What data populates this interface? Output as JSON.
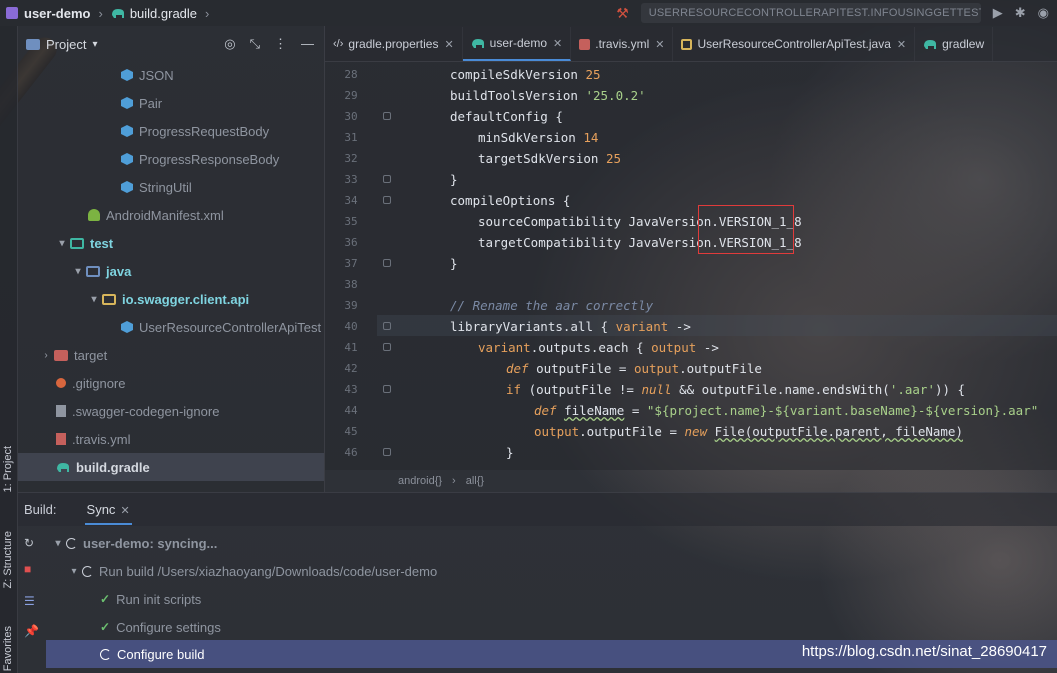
{
  "navbar": {
    "project": "user-demo",
    "file": "build.gradle",
    "run_config": "USERRESOURCECONTROLLERAPITEST.INFOUSINGGETTEST"
  },
  "toolstrip": {
    "project_tab": "1: Project",
    "structure_tab": "Z: Structure",
    "favorites_tab": "Favorites"
  },
  "project_panel": {
    "title": "Project",
    "items": [
      {
        "label": "JSON"
      },
      {
        "label": "Pair"
      },
      {
        "label": "ProgressRequestBody"
      },
      {
        "label": "ProgressResponseBody"
      },
      {
        "label": "StringUtil"
      },
      {
        "label": "AndroidManifest.xml"
      },
      {
        "label": "test"
      },
      {
        "label": "java"
      },
      {
        "label": "io.swagger.client.api"
      },
      {
        "label": "UserResourceControllerApiTest"
      },
      {
        "label": "target"
      },
      {
        "label": ".gitignore"
      },
      {
        "label": ".swagger-codegen-ignore"
      },
      {
        "label": ".travis.yml"
      },
      {
        "label": "build.gradle"
      }
    ]
  },
  "editor": {
    "tabs": [
      {
        "label": "gradle.properties"
      },
      {
        "label": "user-demo"
      },
      {
        "label": ".travis.yml"
      },
      {
        "label": "UserResourceControllerApiTest.java"
      },
      {
        "label": "gradlew"
      }
    ],
    "line_numbers": [
      "28",
      "29",
      "30",
      "31",
      "32",
      "33",
      "34",
      "35",
      "36",
      "37",
      "38",
      "39",
      "40",
      "41",
      "42",
      "43",
      "44",
      "45",
      "46"
    ],
    "code": {
      "l28_a": "compileSdkVersion ",
      "l28_b": "25",
      "l29_a": "buildToolsVersion ",
      "l29_b": "'25.0.2'",
      "l30": "defaultConfig {",
      "l31_a": "minSdkVersion ",
      "l31_b": "14",
      "l32_a": "targetSdkVersion ",
      "l32_b": "25",
      "l33": "}",
      "l34": "compileOptions {",
      "l35": "sourceCompatibility JavaVersion.VERSION_1_8",
      "l36": "targetCompatibility JavaVersion.VERSION_1_8",
      "l37": "}",
      "l39": "// Rename the aar correctly",
      "l40_a": "libraryVariants.all { ",
      "l40_b": "variant",
      "l40_c": " ->",
      "l41_a": "variant",
      "l41_b": ".outputs.each { ",
      "l41_c": "output",
      "l41_d": " ->",
      "l42_a": "def ",
      "l42_b": "outputFile",
      "l42_c": " = ",
      "l42_d": "output",
      "l42_e": ".outputFile",
      "l43_a": "if ",
      "l43_b": "(outputFile != ",
      "l43_c": "null",
      "l43_d": " && outputFile.name.endsWith(",
      "l43_e": "'.aar'",
      "l43_f": ")) {",
      "l44_a": "def ",
      "l44_b": "fileName",
      "l44_c": " = ",
      "l44_d": "\"${project.name}-${variant.baseName}-${version}.aar\"",
      "l45_a": "output",
      "l45_b": ".outputFile = ",
      "l45_c": "new ",
      "l45_d": "File(outputFile.parent, fileName)",
      "l46": "}"
    },
    "breadcrumb": [
      "android{}",
      "all{}"
    ]
  },
  "build": {
    "label": "Build:",
    "tab": "Sync",
    "rows": [
      {
        "label": "user-demo: syncing..."
      },
      {
        "label": "Run build /Users/xiazhaoyang/Downloads/code/user-demo"
      },
      {
        "label": "Run init scripts"
      },
      {
        "label": "Configure settings"
      },
      {
        "label": "Configure build"
      }
    ]
  },
  "watermark": "https://blog.csdn.net/sinat_28690417"
}
